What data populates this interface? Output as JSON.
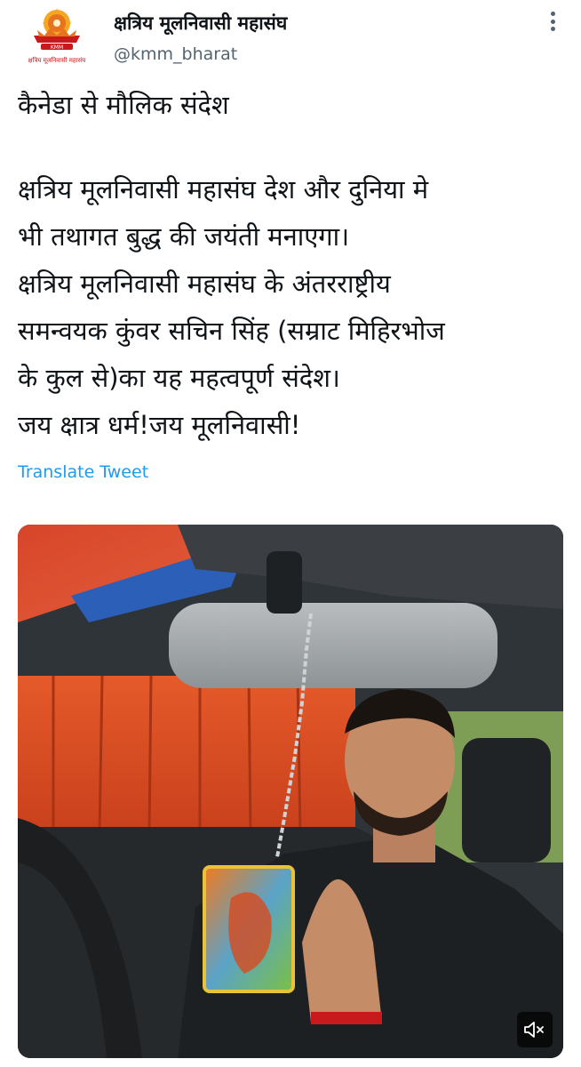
{
  "tweet": {
    "author": {
      "display_name": "क्षत्रिय मूलनिवासी महासंघ",
      "handle": "@kmm_bharat",
      "avatar_text": "KMM",
      "avatar_caption": "क्षत्रिय मूलनिवासी महासंघ"
    },
    "title": "कैनेडा से मौलिक संदेश",
    "body": "क्षत्रिय मूलनिवासी महासंघ देश और दुनिया मे\nभी तथागत बुद्ध की जयंती मनाएगा।\nक्षत्रिय मूलनिवासी महासंघ के अंतरराष्ट्रीय\nसमन्वयक कुंवर सचिन सिंह (सम्राट मिहिरभोज\nके कुल से)का यह महत्वपूर्ण संदेश।\nजय क्षात्र धर्म!जय मूलनिवासी!",
    "translate_label": "Translate Tweet",
    "media": {
      "type": "video",
      "mute_icon": "speaker-muted-icon"
    }
  },
  "icons": {
    "more": "more-vertical-icon"
  },
  "colors": {
    "link_blue": "#1d9bf0",
    "secondary_text": "#536471",
    "primary_text": "#0f1419",
    "logo_orange": "#e8731e",
    "logo_red": "#c8191d"
  }
}
